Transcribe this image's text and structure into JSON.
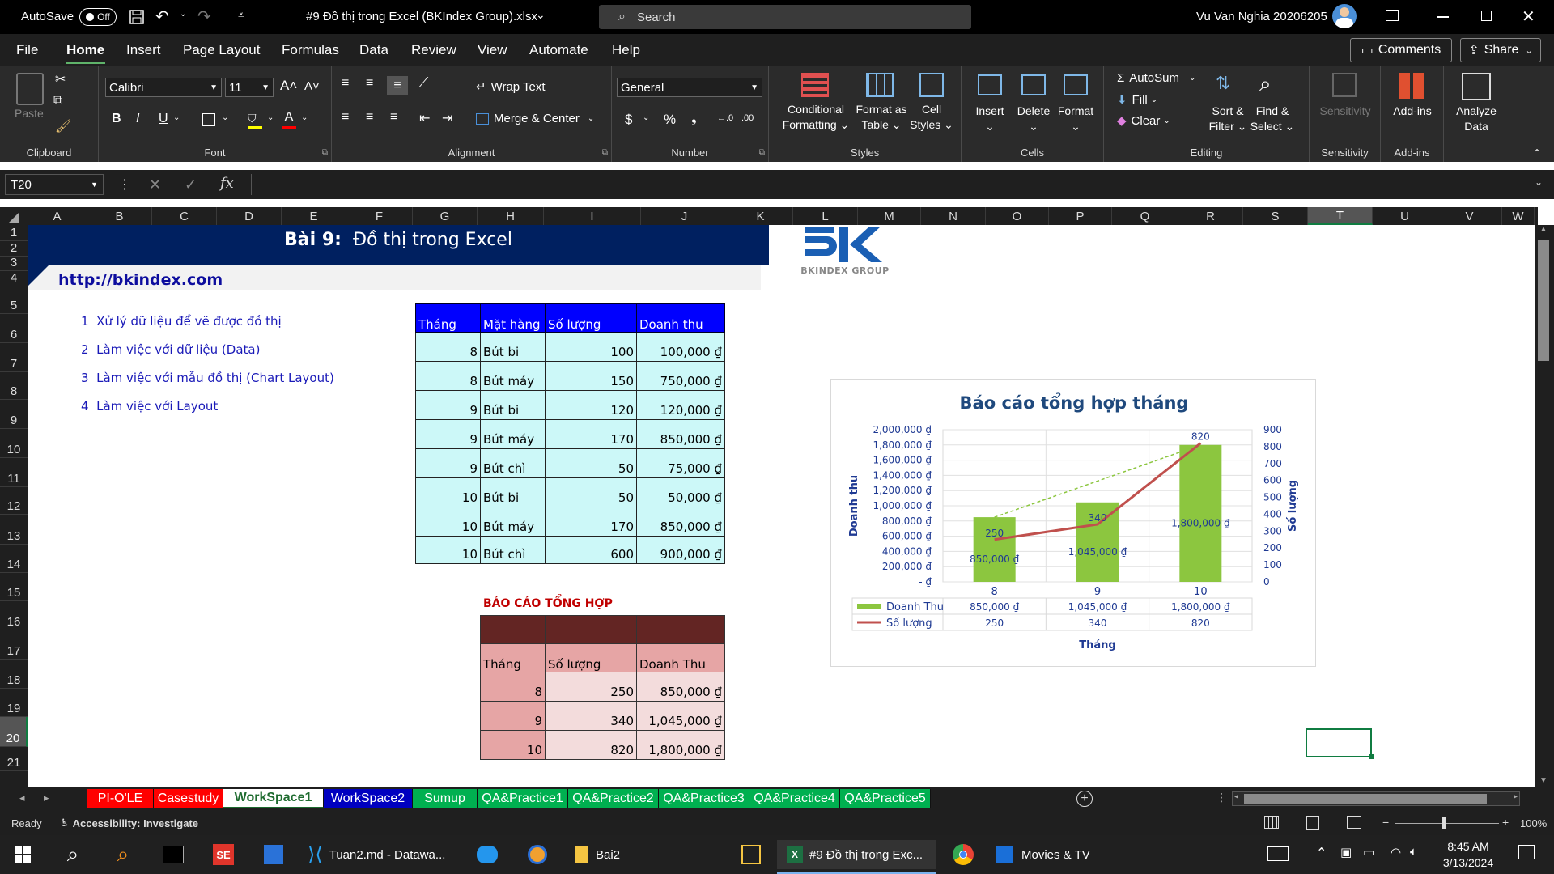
{
  "titlebar": {
    "autosave_label": "AutoSave",
    "autosave_state": "Off",
    "file_title": "#9 Đồ thị trong Excel (BKIndex Group).xlsx",
    "search_placeholder": "Search",
    "user_name": "Vu Van Nghia 20206205"
  },
  "menu": {
    "tabs": [
      "File",
      "Home",
      "Insert",
      "Page Layout",
      "Formulas",
      "Data",
      "Review",
      "View",
      "Automate",
      "Help"
    ],
    "active": "Home",
    "comments_label": "Comments",
    "share_label": "Share"
  },
  "ribbon": {
    "clipboard": {
      "paste": "Paste",
      "label": "Clipboard"
    },
    "font": {
      "name": "Calibri",
      "size": "11",
      "label": "Font"
    },
    "alignment": {
      "wrap": "Wrap Text",
      "merge": "Merge & Center",
      "label": "Alignment"
    },
    "number": {
      "format": "General",
      "label": "Number"
    },
    "styles": {
      "cond1": "Conditional",
      "cond2": "Formatting",
      "fmt1": "Format as",
      "fmt2": "Table",
      "cell1": "Cell",
      "cell2": "Styles",
      "label": "Styles"
    },
    "cells": {
      "insert": "Insert",
      "delete": "Delete",
      "format": "Format",
      "label": "Cells"
    },
    "editing": {
      "autosum": "AutoSum",
      "fill": "Fill",
      "clear": "Clear",
      "sort1": "Sort &",
      "sort2": "Filter",
      "find1": "Find &",
      "find2": "Select",
      "label": "Editing"
    },
    "sensitivity": {
      "btn": "Sensitivity",
      "label": "Sensitivity"
    },
    "addins": {
      "btn": "Add-ins",
      "label": "Add-ins"
    },
    "analyze": {
      "l1": "Analyze",
      "l2": "Data"
    }
  },
  "formula_bar": {
    "name_box": "T20",
    "fx": "fx",
    "content": ""
  },
  "columns": [
    "A",
    "B",
    "C",
    "D",
    "E",
    "F",
    "G",
    "H",
    "I",
    "J",
    "K",
    "L",
    "M",
    "N",
    "O",
    "P",
    "Q",
    "R",
    "S",
    "T",
    "U",
    "V",
    "W"
  ],
  "rows": [
    "1",
    "2",
    "3",
    "4",
    "5",
    "6",
    "7",
    "8",
    "9",
    "10",
    "11",
    "12",
    "13",
    "14",
    "15",
    "16",
    "17",
    "18",
    "19",
    "20",
    "21"
  ],
  "sheet": {
    "banner_prefix": "Bài 9:",
    "banner_title": "Đồ thị trong Excel",
    "link": "http://bkindex.com",
    "logo_text": "BKINDEX GROUP",
    "outline": [
      {
        "num": "1",
        "text": "Xử lý dữ liệu để vẽ được đồ thị"
      },
      {
        "num": "2",
        "text": "Làm việc với dữ liệu (Data)"
      },
      {
        "num": "3",
        "text": "Làm việc với mẫu đồ thị (Chart Layout)"
      },
      {
        "num": "4",
        "text": "Làm việc với Layout"
      }
    ],
    "table1": {
      "headers": [
        "Tháng",
        "Mặt hàng",
        "Số lượng",
        "Doanh thu"
      ],
      "rows": [
        [
          "8",
          "Bút bi",
          "100",
          "100,000 ₫"
        ],
        [
          "8",
          "Bút máy",
          "150",
          "750,000 ₫"
        ],
        [
          "9",
          "Bút bi",
          "120",
          "120,000 ₫"
        ],
        [
          "9",
          "Bút máy",
          "170",
          "850,000 ₫"
        ],
        [
          "9",
          "Bút chì",
          "50",
          "75,000 ₫"
        ],
        [
          "10",
          "Bút bi",
          "50",
          "50,000 ₫"
        ],
        [
          "10",
          "Bút máy",
          "170",
          "850,000 ₫"
        ],
        [
          "10",
          "Bút chì",
          "600",
          "900,000 ₫"
        ]
      ]
    },
    "table2_title": "BÁO CÁO TỔNG HỢP",
    "table2": {
      "headers": [
        "Tháng",
        "Số lượng",
        "Doanh Thu"
      ],
      "rows": [
        [
          "8",
          "250",
          "850,000 ₫"
        ],
        [
          "9",
          "340",
          "1,045,000 ₫"
        ],
        [
          "10",
          "820",
          "1,800,000 ₫"
        ]
      ]
    }
  },
  "chart_data": {
    "type": "bar",
    "title": "Báo cáo tổng hợp tháng",
    "xlabel": "Tháng",
    "ylabel": "Doanh thu",
    "y2label": "Số lượng",
    "categories": [
      "8",
      "9",
      "10"
    ],
    "ylim": [
      0,
      2000000
    ],
    "y2lim": [
      0,
      900
    ],
    "y_ticks": [
      "2,000,000 ₫",
      "1,800,000 ₫",
      "1,600,000 ₫",
      "1,400,000 ₫",
      "1,200,000 ₫",
      "1,000,000 ₫",
      "800,000 ₫",
      "600,000 ₫",
      "400,000 ₫",
      "200,000 ₫",
      "- ₫"
    ],
    "y2_ticks": [
      "900",
      "800",
      "700",
      "600",
      "500",
      "400",
      "300",
      "200",
      "100",
      "0"
    ],
    "series": [
      {
        "name": "Doanh Thu",
        "kind": "bar",
        "axis": "left",
        "color": "#8cc63f",
        "values": [
          850000,
          1045000,
          1800000
        ],
        "labels": [
          "850,000 ₫",
          "1,045,000 ₫",
          "1,800,000 ₫"
        ]
      },
      {
        "name": "Số lượng",
        "kind": "line",
        "axis": "right",
        "color": "#c0504d",
        "values": [
          250,
          340,
          820
        ],
        "labels": [
          "250",
          "340",
          "820"
        ]
      }
    ],
    "trendline": {
      "color": "#8cc63f",
      "style": "dashed"
    },
    "data_table": true,
    "grid": true
  },
  "sheet_tabs": [
    {
      "name": "PI-O'LE",
      "bg": "#ff0000",
      "fg": "#ffffff"
    },
    {
      "name": "Casestudy",
      "bg": "#ff0000",
      "fg": "#ffffff"
    },
    {
      "name": "WorkSpace1",
      "bg": "#ffffff",
      "fg": "#1e6b2f",
      "active": true
    },
    {
      "name": "WorkSpace2",
      "bg": "#0000c0",
      "fg": "#ffffff"
    },
    {
      "name": "Sumup",
      "bg": "#00b050",
      "fg": "#ffffff"
    },
    {
      "name": "QA&Practice1",
      "bg": "#00b050",
      "fg": "#ffffff"
    },
    {
      "name": "QA&Practice2",
      "bg": "#00b050",
      "fg": "#ffffff"
    },
    {
      "name": "QA&Practice3",
      "bg": "#00b050",
      "fg": "#ffffff"
    },
    {
      "name": "QA&Practice4",
      "bg": "#00b050",
      "fg": "#ffffff"
    },
    {
      "name": "QA&Practice5",
      "bg": "#00b050",
      "fg": "#ffffff"
    }
  ],
  "status": {
    "ready": "Ready",
    "accessibility": "Accessibility: Investigate",
    "zoom": "100%"
  },
  "taskbar": {
    "apps": [
      "Tuan2.md - Datawa...",
      "Bai2",
      "#9 Đồ thị trong Exc...",
      "Movies & TV"
    ],
    "time": "8:45 AM",
    "date": "3/13/2024"
  }
}
